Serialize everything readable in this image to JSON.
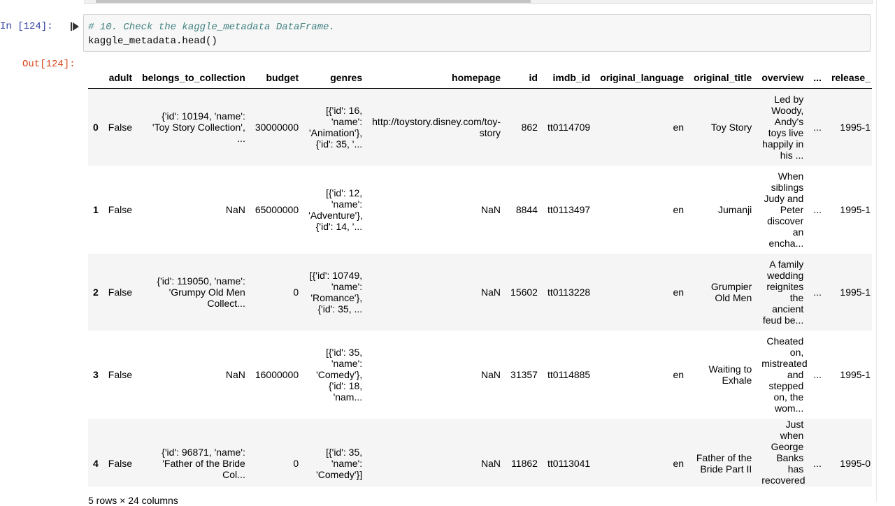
{
  "cell": {
    "in_prompt": "In [124]:",
    "out_prompt": "Out[124]:",
    "comment_line": "# 10. Check the kaggle_metadata DataFrame.",
    "code_line": "kaggle_metadata.head()"
  },
  "table": {
    "columns": [
      "",
      "adult",
      "belongs_to_collection",
      "budget",
      "genres",
      "homepage",
      "id",
      "imdb_id",
      "original_language",
      "original_title",
      "overview",
      "...",
      "release_"
    ],
    "rows": [
      {
        "index": "0",
        "adult": "False",
        "collection": "{'id': 10194, 'name': 'Toy Story Collection', ...",
        "budget": "30000000",
        "genres": "[{'id': 16, 'name': 'Animation'}, {'id': 35, '...",
        "homepage": "http://toystory.disney.com/toy-story",
        "id": "862",
        "imdb_id": "tt0114709",
        "language": "en",
        "title": "Toy Story",
        "overview": "Led by Woody, Andy's toys live happily in his ...",
        "ellipsis": "...",
        "release": "1995-1"
      },
      {
        "index": "1",
        "adult": "False",
        "collection": "NaN",
        "budget": "65000000",
        "genres": "[{'id': 12, 'name': 'Adventure'}, {'id': 14, '...",
        "homepage": "NaN",
        "id": "8844",
        "imdb_id": "tt0113497",
        "language": "en",
        "title": "Jumanji",
        "overview": "When siblings Judy and Peter discover an encha...",
        "ellipsis": "...",
        "release": "1995-1"
      },
      {
        "index": "2",
        "adult": "False",
        "collection": "{'id': 119050, 'name': 'Grumpy Old Men Collect...",
        "budget": "0",
        "genres": "[{'id': 10749, 'name': 'Romance'}, {'id': 35, ...",
        "homepage": "NaN",
        "id": "15602",
        "imdb_id": "tt0113228",
        "language": "en",
        "title": "Grumpier Old Men",
        "overview": "A family wedding reignites the ancient feud be...",
        "ellipsis": "...",
        "release": "1995-1"
      },
      {
        "index": "3",
        "adult": "False",
        "collection": "NaN",
        "budget": "16000000",
        "genres": "[{'id': 35, 'name': 'Comedy'}, {'id': 18, 'nam...",
        "homepage": "NaN",
        "id": "31357",
        "imdb_id": "tt0114885",
        "language": "en",
        "title": "Waiting to Exhale",
        "overview": "Cheated on, mistreated and stepped on, the wom...",
        "ellipsis": "...",
        "release": "1995-1"
      },
      {
        "index": "4",
        "adult": "False",
        "collection": "{'id': 96871, 'name': 'Father of the Bride Col...",
        "budget": "0",
        "genres": "[{'id': 35, 'name': 'Comedy'}]",
        "homepage": "NaN",
        "id": "11862",
        "imdb_id": "tt0113041",
        "language": "en",
        "title": "Father of the Bride Part II",
        "overview": "Just when George Banks has recovered from his ...",
        "ellipsis": "...",
        "release": "1995-0"
      }
    ]
  },
  "footer": "5 rows × 24 columns",
  "colors": {
    "in_prompt": "#303f9f",
    "out_prompt": "#d84315",
    "comment": "#408080"
  }
}
